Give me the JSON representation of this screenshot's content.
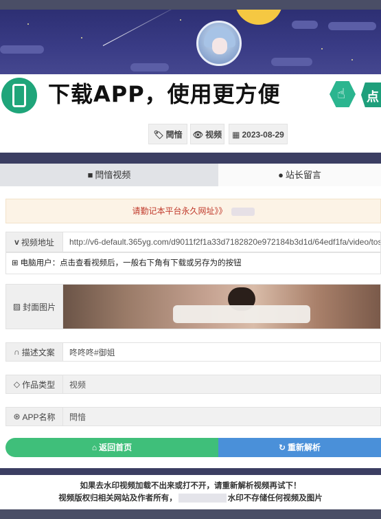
{
  "banner": {
    "text": "下载APP，使用更方便",
    "click_text": "点"
  },
  "meta": {
    "app_tag": "閆愔",
    "type_tag": "视频",
    "date_tag": "2023-08-29"
  },
  "tabs": [
    {
      "label": "閆愔视频"
    },
    {
      "label": "站长留言"
    }
  ],
  "notice": {
    "text": "请勤记本平台永久网址》》"
  },
  "video_url": {
    "label": "视频地址",
    "value": "http://v6-default.365yg.com/d9011f2f1a33d7182820e972184b3d1d/64edf1fa/video/tos"
  },
  "pc_tip": {
    "text": "电脑用户：点击查看视频后，一般右下角有下载或另存为的按钮"
  },
  "cover": {
    "label": "封面图片"
  },
  "description": {
    "label": "描述文案",
    "value": "咚咚咚#御姐"
  },
  "work_type": {
    "label": "作品类型",
    "value": "视频"
  },
  "app_name": {
    "label": "APP名称",
    "value": "閆愔"
  },
  "buttons": {
    "home": "返回首页",
    "reparse": "重新解析"
  },
  "footer": {
    "line1": "如果去水印视频加载不出来或打不开，请重新解析视频再试下！",
    "line2_prefix": "视频版权归相关网站及作者所有，",
    "line2_suffix": "水印不存储任何视频及图片"
  },
  "colors": {
    "accent_green": "#3fbf7a",
    "accent_blue": "#4a90d9",
    "notice_red": "#c0392b",
    "header_bg": "#2d2f73"
  }
}
